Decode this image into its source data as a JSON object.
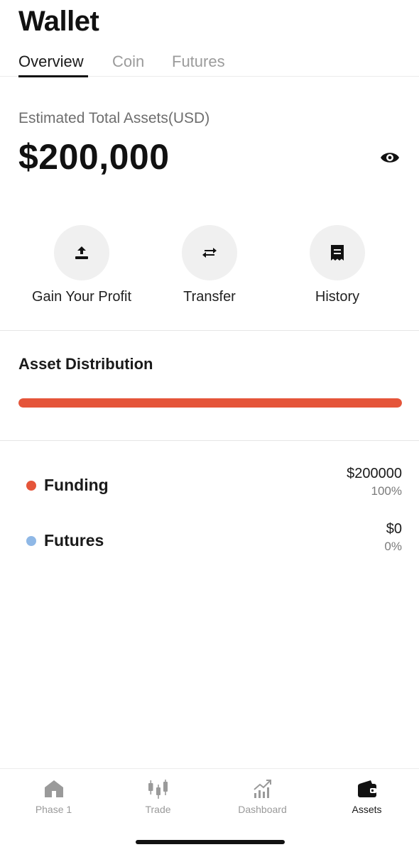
{
  "header": {
    "title": "Wallet"
  },
  "tabs": [
    {
      "label": "Overview",
      "active": true
    },
    {
      "label": "Coin",
      "active": false
    },
    {
      "label": "Futures",
      "active": false
    }
  ],
  "summary": {
    "label": "Estimated Total Assets(USD)",
    "value": "$200,000",
    "visibility_icon": "eye-icon"
  },
  "actions": [
    {
      "label": "Gain Your Profit",
      "icon": "upload-icon"
    },
    {
      "label": "Transfer",
      "icon": "transfer-icon"
    },
    {
      "label": "History",
      "icon": "receipt-icon"
    }
  ],
  "distribution": {
    "title": "Asset Distribution",
    "funding_fraction": 1.0,
    "bar_color": "#e5553a"
  },
  "assets": [
    {
      "name": "Funding",
      "amount": "$200000",
      "percent": "100%",
      "color": "#e5553a"
    },
    {
      "name": "Futures",
      "amount": "$0",
      "percent": "0%",
      "color": "#8fb8e6"
    }
  ],
  "nav": [
    {
      "label": "Phase 1",
      "icon": "home-icon",
      "active": false
    },
    {
      "label": "Trade",
      "icon": "candlestick-icon",
      "active": false
    },
    {
      "label": "Dashboard",
      "icon": "chart-icon",
      "active": false
    },
    {
      "label": "Assets",
      "icon": "wallet-icon",
      "active": true
    }
  ]
}
